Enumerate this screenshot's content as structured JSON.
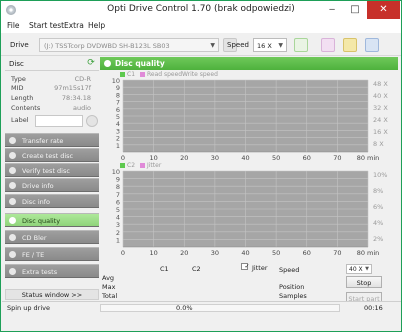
{
  "window": {
    "title": "Opti Drive Control 1.70 (brak odpowiedzi)",
    "minimize_glyph": "‒",
    "maximize_glyph": "□",
    "close_glyph": "✕"
  },
  "menu": [
    "File",
    "Start test",
    "Extra",
    "Help"
  ],
  "toolbar": {
    "drive_label": "Drive",
    "drive_value": "(J:)  TSSTcorp DVDWBD SH-B123L SB03",
    "speed_label": "Speed",
    "speed_value": "16 X"
  },
  "disc": {
    "header": "Disc",
    "fields": [
      {
        "key": "Type",
        "value": "CD-R"
      },
      {
        "key": "MID",
        "value": "97m15s17f"
      },
      {
        "key": "Length",
        "value": "78:34.18"
      },
      {
        "key": "Contents",
        "value": "audio"
      }
    ],
    "label_key": "Label"
  },
  "nav": [
    {
      "label": "Transfer rate",
      "active": false
    },
    {
      "label": "Create test disc",
      "active": false
    },
    {
      "label": "Verify test disc",
      "active": false
    },
    {
      "label": "Drive info",
      "active": false
    },
    {
      "label": "Disc info",
      "active": false
    },
    {
      "label": "Disc quality",
      "active": true
    },
    {
      "label": "CD Bler",
      "active": false
    },
    {
      "label": "FE / TE",
      "active": false
    },
    {
      "label": "Extra tests",
      "active": false
    }
  ],
  "status_window_button": "Status window >>",
  "panel": {
    "title": "Disc quality",
    "legend1": [
      {
        "name": "C1",
        "color": "#5ec94f"
      },
      {
        "name": "Read speed",
        "color": "#e08ad8"
      },
      {
        "name": "Write speed",
        "color": null
      }
    ],
    "legend2": [
      {
        "name": "C2",
        "color": "#5ec94f"
      },
      {
        "name": "Jitter",
        "color": "#e08ad8"
      }
    ]
  },
  "chart_data": [
    {
      "type": "line",
      "x_ticks": [
        "0",
        "10",
        "20",
        "30",
        "40",
        "50",
        "60",
        "70",
        "80 min"
      ],
      "y_left_ticks": [
        "10",
        "9",
        "8",
        "7",
        "6",
        "5",
        "4",
        "3",
        "2",
        "1"
      ],
      "y_right_ticks": [
        "48 X",
        "40 X",
        "32 X",
        "24 X",
        "16 X",
        "8 X"
      ],
      "xlim": [
        0,
        80
      ],
      "ylim": [
        0,
        10
      ],
      "grid": true,
      "series": [
        {
          "name": "C1",
          "values": []
        },
        {
          "name": "Read speed",
          "values": []
        },
        {
          "name": "Write speed",
          "values": []
        }
      ]
    },
    {
      "type": "line",
      "x_ticks": [
        "0",
        "10",
        "20",
        "30",
        "40",
        "50",
        "60",
        "70",
        "80 min"
      ],
      "y_left_ticks": [
        "10",
        "9",
        "8",
        "7",
        "6",
        "5",
        "4",
        "3",
        "2",
        "1"
      ],
      "y_right_ticks": [
        "10%",
        "8%",
        "6%",
        "4%",
        "2%"
      ],
      "xlim": [
        0,
        80
      ],
      "ylim": [
        0,
        10
      ],
      "grid": true,
      "series": [
        {
          "name": "C2",
          "values": []
        },
        {
          "name": "Jitter",
          "values": []
        }
      ]
    }
  ],
  "stats": {
    "col_c1": "C1",
    "col_c2": "C2",
    "jitter_label": "Jitter",
    "jitter_checked": true,
    "check_glyph": "✓",
    "rows": [
      "Avg",
      "Max",
      "Total"
    ],
    "speed_label": "Speed",
    "position_label": "Position",
    "samples_label": "Samples",
    "speed_value": "40 X",
    "stop_button": "Stop",
    "start_part_button": "Start part"
  },
  "statusbar": {
    "left": "Spin up drive",
    "progress_text": "0.0%",
    "progress": 0.0,
    "time": "00:16"
  },
  "colors": {
    "accent_green": "#5ec94f",
    "grid_bg": "#a6a6a6",
    "close_red": "#c7302a"
  }
}
